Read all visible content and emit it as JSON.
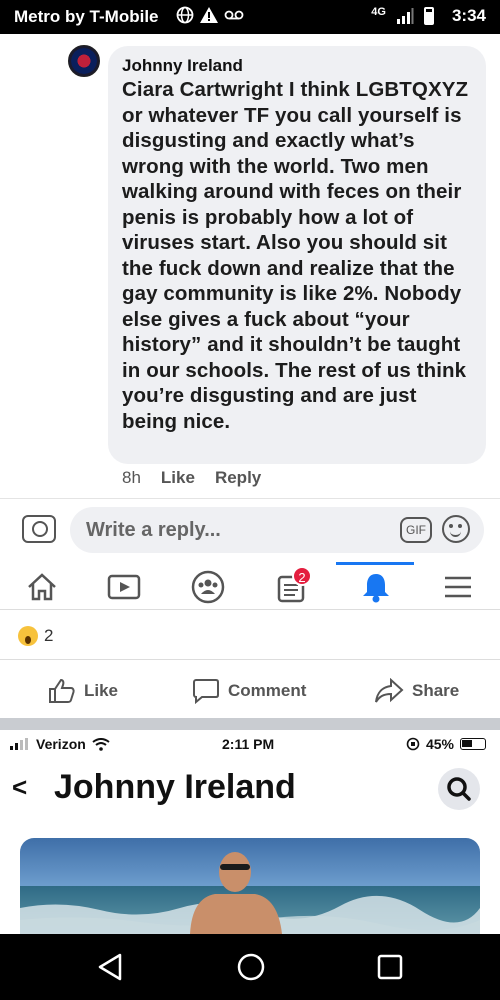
{
  "status_bar": {
    "carrier": "Metro by T-Mobile",
    "network": "4G",
    "time": "3:34"
  },
  "comment": {
    "author": "Johnny Ireland",
    "mention": "Ciara Cartwright",
    "text": "I think LGBTQXYZ or whatever TF you call yourself is disgusting and exactly what’s wrong with the world. Two men walking around with feces on their penis is probably how a lot of viruses start. Also you should sit the fuck down and realize that the gay community is like 2%. Nobody else gives a fuck about “your history” and it shouldn’t be taught in our schools. The rest of us think you’re disgusting and are just being nice.",
    "age": "8h",
    "like_label": "Like",
    "reply_label": "Reply"
  },
  "reply_bar": {
    "placeholder": "Write a reply...",
    "gif_label": "GIF"
  },
  "fb_nav": {
    "notifications_badge": "2",
    "items": [
      "home-icon",
      "watch-icon",
      "groups-icon",
      "news-icon",
      "bell-icon",
      "menu-icon"
    ]
  },
  "reactions": {
    "count": "2"
  },
  "actions": {
    "like": "Like",
    "comment": "Comment",
    "share": "Share"
  },
  "ios": {
    "carrier": "Verizon",
    "time": "2:11 PM",
    "battery": "45%",
    "profile_name": "Johnny Ireland"
  },
  "colors": {
    "fb_blue": "#1877f2",
    "bubble_bg": "#eff0f3",
    "badge_red": "#e41e3f"
  }
}
